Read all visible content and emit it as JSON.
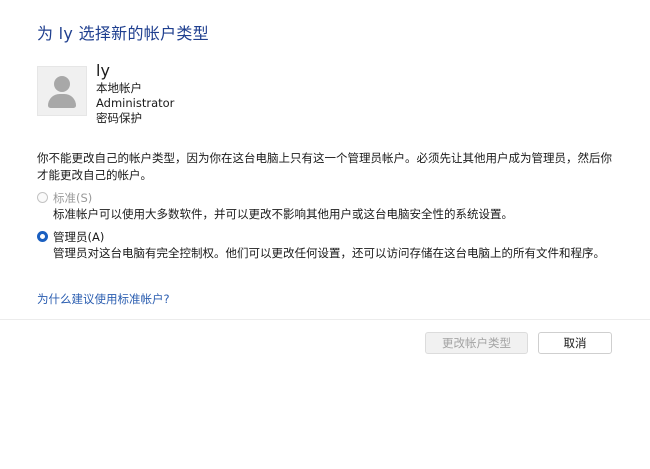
{
  "header": {
    "title": "为 ly 选择新的帐户类型"
  },
  "user": {
    "name": "ly",
    "account_location": "本地帐户",
    "account_type": "Administrator",
    "password_status": "密码保护",
    "avatar_icon": "user-avatar-icon"
  },
  "notice": {
    "text": "你不能更改自己的帐户类型，因为你在这台电脑上只有这一个管理员帐户。必须先让其他用户成为管理员，然后你才能更改自己的帐户。"
  },
  "options": {
    "standard": {
      "label": "标准(S)",
      "description": "标准帐户可以使用大多数软件，并可以更改不影响其他用户或这台电脑安全性的系统设置。",
      "selected": false,
      "enabled": false
    },
    "administrator": {
      "label": "管理员(A)",
      "description": "管理员对这台电脑有完全控制权。他们可以更改任何设置，还可以访问存储在这台电脑上的所有文件和程序。",
      "selected": true,
      "enabled": true
    }
  },
  "help_link": {
    "text": "为什么建议使用标准帐户?"
  },
  "footer": {
    "change_button_label": "更改帐户类型",
    "cancel_button_label": "取消"
  },
  "colors": {
    "title": "#1f3f8f",
    "link": "#2a5db0",
    "radio_selected": "#1a5fc0",
    "disabled_text": "#9a9a9a"
  }
}
